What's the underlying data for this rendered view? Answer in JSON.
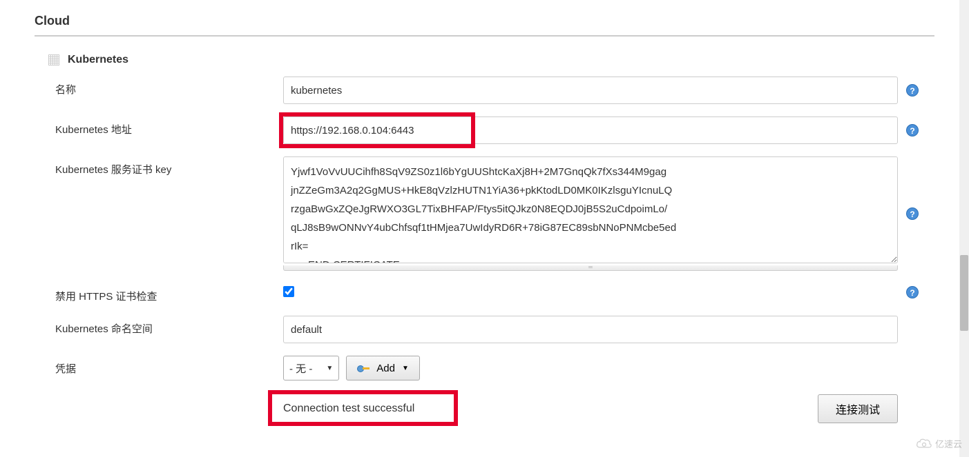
{
  "section": {
    "title": "Cloud"
  },
  "cloud": {
    "header": "Kubernetes"
  },
  "fields": {
    "name": {
      "label": "名称",
      "value": "kubernetes"
    },
    "url": {
      "label": "Kubernetes 地址",
      "value": "https://192.168.0.104:6443"
    },
    "cert": {
      "label": "Kubernetes 服务证书 key",
      "value": "Yjwf1VoVvUUCihfh8SqV9ZS0z1l6bYgUUShtcKaXj8H+2M7GnqQk7fXs344M9gag\njnZZeGm3A2q2GgMUS+HkE8qVzlzHUTN1YiA36+pkKtodLD0MK0IKzlsguYIcnuLQ\nrzgaBwGxZQeJgRWXO3GL7TixBHFAP/Ftys5itQJkz0N8EQDJ0jB5S2uCdpoimLo/\nqLJ8sB9wONNvY4ubChfsqf1tHMjea7UwIdyRD6R+78iG87EC89sbNNoPNMcbe5ed\nrIk=\n-----END CERTIFICATE-----"
    },
    "disable_https": {
      "label": "禁用 HTTPS 证书检查",
      "checked": true
    },
    "namespace": {
      "label": "Kubernetes 命名空间",
      "value": "default"
    },
    "credentials": {
      "label": "凭据",
      "selected": "- 无 -",
      "add_label": "Add"
    }
  },
  "status": {
    "message": "Connection test successful"
  },
  "buttons": {
    "test_connection": "连接测试"
  },
  "watermark": {
    "text": "亿速云"
  }
}
